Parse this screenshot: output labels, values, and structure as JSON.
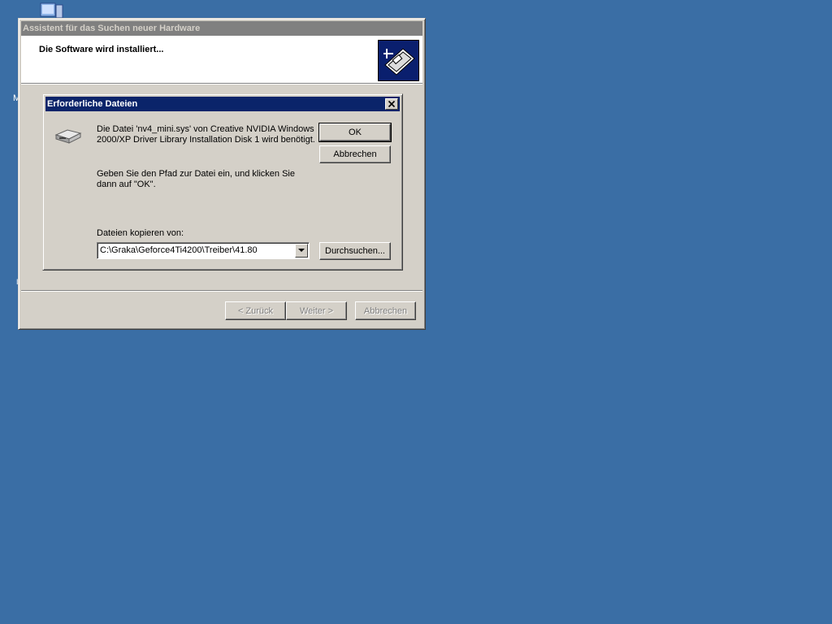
{
  "wizard": {
    "title": "Assistent für das Suchen neuer Hardware",
    "heading": "Die Software wird installiert...",
    "buttons": {
      "back": "< Zurück",
      "next": "Weiter >",
      "cancel": "Abbrechen"
    }
  },
  "dialog": {
    "title": "Erforderliche Dateien",
    "message": "Die Datei 'nv4_mini.sys' von Creative NVIDIA Windows 2000/XP Driver Library Installation Disk 1 wird benötigt.",
    "instruction": "Geben Sie den Pfad zur Datei ein, und klicken Sie dann auf \"OK\".",
    "copy_from_label": "Dateien kopieren von:",
    "copy_from_value": "C:\\Graka\\Geforce4Ti4200\\Treiber\\41.80",
    "ok_label": "OK",
    "cancel_label": "Abbrechen",
    "browse_label": "Durchsuchen..."
  },
  "desktop": {
    "fragment_1": "M",
    "fragment_2": "I",
    "background_color": "#3a6ea5"
  }
}
